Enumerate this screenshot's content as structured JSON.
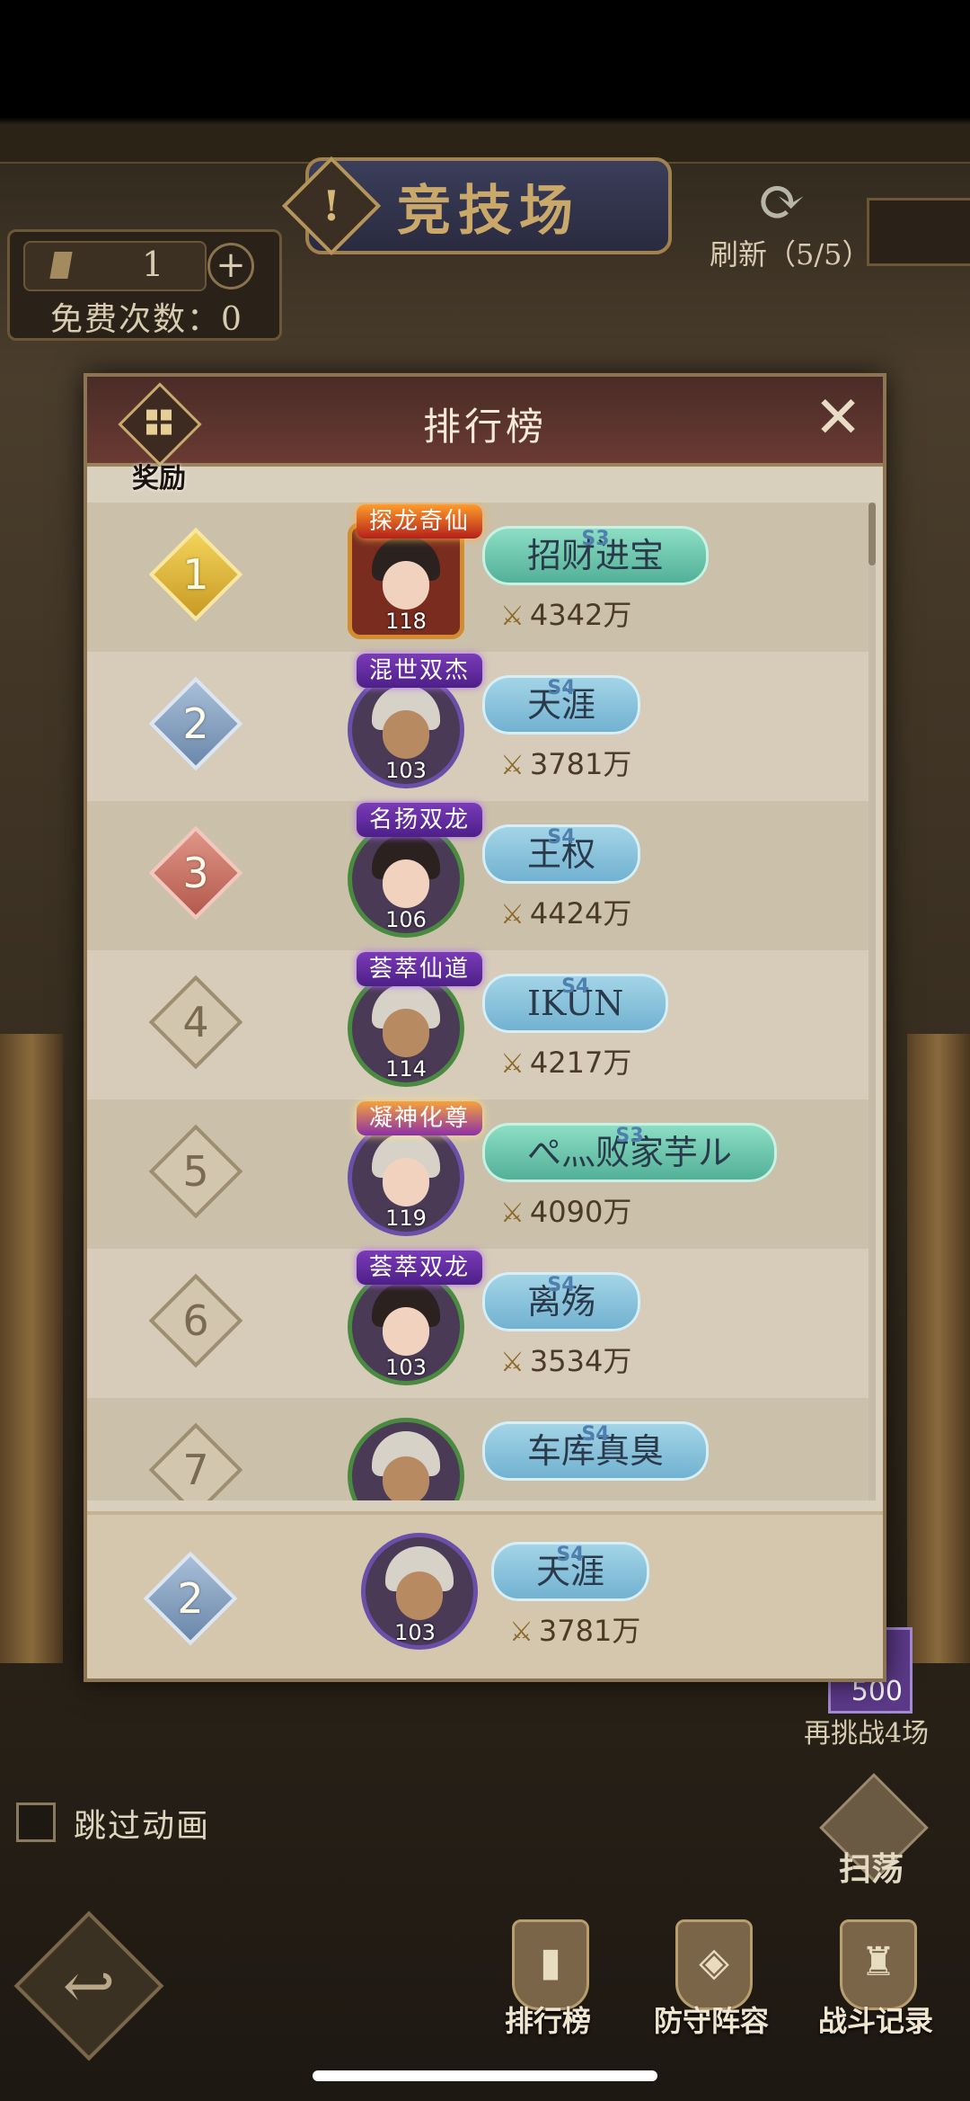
{
  "header": {
    "title": "竞技场",
    "alert_icon": "!",
    "ticket_count": "1",
    "plus": "+",
    "free_label": "免费次数：0",
    "refresh_icon": "⟳",
    "refresh_label": "刷新（5/5）"
  },
  "modal": {
    "title": "排行榜",
    "reward_label": "奖励",
    "close": "✕"
  },
  "ranking": [
    {
      "rank": "1",
      "tier": "gold",
      "badge": "探龙奇仙",
      "badge_style": "fire",
      "level": "118",
      "season": "S3",
      "name": "招财进宝",
      "plate": "green",
      "power": "4342万",
      "frame": "gold",
      "hair": "dark",
      "face": "light"
    },
    {
      "rank": "2",
      "tier": "silver",
      "badge": "混世双杰",
      "badge_style": "purple",
      "level": "103",
      "season": "S4",
      "name": "天涯",
      "plate": "blue",
      "power": "3781万",
      "frame": "purple",
      "hair": "light",
      "face": "dark"
    },
    {
      "rank": "3",
      "tier": "bronze",
      "badge": "名扬双龙",
      "badge_style": "purple",
      "level": "106",
      "season": "S4",
      "name": "王权",
      "plate": "blue",
      "power": "4424万",
      "frame": "green",
      "hair": "dark",
      "face": "light"
    },
    {
      "rank": "4",
      "tier": "plain",
      "badge": "荟萃仙道",
      "badge_style": "purple",
      "level": "114",
      "season": "S4",
      "name": "IKUN",
      "plate": "blue",
      "power": "4217万",
      "frame": "green",
      "hair": "light",
      "face": "dark"
    },
    {
      "rank": "5",
      "tier": "plain",
      "badge": "凝神化尊",
      "badge_style": "gold",
      "level": "119",
      "season": "S3",
      "name": "ぺ灬败家芋ル",
      "plate": "green",
      "power": "4090万",
      "frame": "purple",
      "hair": "light",
      "face": "light"
    },
    {
      "rank": "6",
      "tier": "plain",
      "badge": "荟萃双龙",
      "badge_style": "purple",
      "level": "103",
      "season": "S4",
      "name": "离殇",
      "plate": "blue",
      "power": "3534万",
      "frame": "green",
      "hair": "dark",
      "face": "light"
    },
    {
      "rank": "7",
      "tier": "plain",
      "badge": "",
      "badge_style": "none",
      "level": "",
      "season": "S4",
      "name": "车库真臭",
      "plate": "blue",
      "power": "",
      "frame": "green",
      "hair": "light",
      "face": "dark"
    }
  ],
  "my_rank": {
    "rank": "2",
    "tier": "silver",
    "level": "103",
    "season": "S4",
    "name": "天涯",
    "power": "3781万"
  },
  "bottom": {
    "price": "500",
    "rechallenge": "再挑战4场",
    "skip_label": "跳过动画",
    "sweep_label": "扫荡",
    "back_icon": "↩",
    "nav": [
      {
        "label": "排行榜",
        "icon": "▮"
      },
      {
        "label": "防守阵容",
        "icon": "◈"
      },
      {
        "label": "战斗记录",
        "icon": "♜"
      }
    ]
  }
}
